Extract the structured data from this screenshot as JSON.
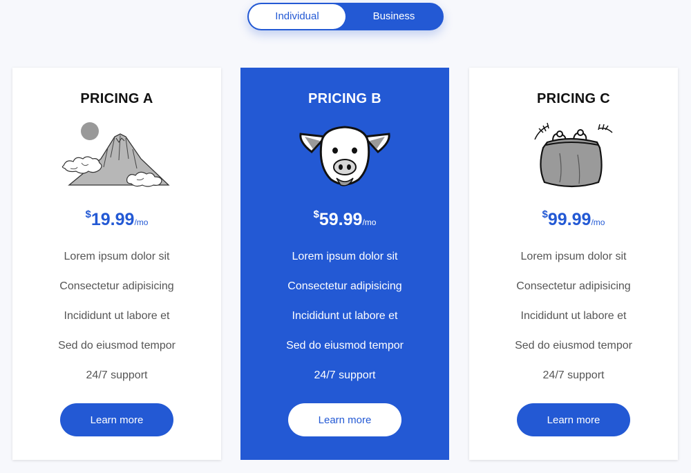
{
  "toggle": {
    "individual_label": "Individual",
    "business_label": "Business",
    "selected": "Individual"
  },
  "colors": {
    "accent": "#2359d4",
    "background": "#f7f8fc"
  },
  "plans": [
    {
      "title": "PRICING A",
      "icon": "mountain-icon",
      "currency": "$",
      "amount": "19.99",
      "period": "/mo",
      "features": [
        "Lorem ipsum dolor sit",
        "Consectetur adipisicing",
        "Incididunt ut labore et",
        "Sed do eiusmod tempor",
        "24/7 support"
      ],
      "button_label": "Learn more"
    },
    {
      "title": "PRICING B",
      "icon": "pig-icon",
      "currency": "$",
      "amount": "59.99",
      "period": "/mo",
      "features": [
        "Lorem ipsum dolor sit",
        "Consectetur adipisicing",
        "Incididunt ut labore et",
        "Sed do eiusmod tempor",
        "24/7 support"
      ],
      "button_label": "Learn more"
    },
    {
      "title": "PRICING C",
      "icon": "coin-purse-icon",
      "currency": "$",
      "amount": "99.99",
      "period": "/mo",
      "features": [
        "Lorem ipsum dolor sit",
        "Consectetur adipisicing",
        "Incididunt ut labore et",
        "Sed do eiusmod tempor",
        "24/7 support"
      ],
      "button_label": "Learn more"
    }
  ]
}
